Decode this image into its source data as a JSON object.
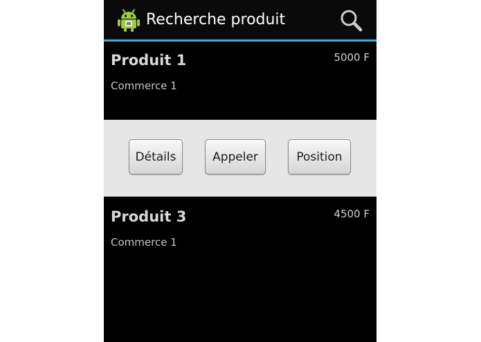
{
  "action_bar": {
    "title": "Recherche produit",
    "app_icon": "android-icon",
    "search_icon": "search-icon",
    "accent_color": "#33b5e5"
  },
  "products": [
    {
      "name": "Produit 1",
      "shop": "Commerce 1",
      "price": "5000 F"
    },
    {
      "name": "Produit 3",
      "shop": "Commerce 1",
      "price": "4500 F"
    }
  ],
  "actions": {
    "details_label": "Détails",
    "call_label": "Appeler",
    "position_label": "Position"
  }
}
